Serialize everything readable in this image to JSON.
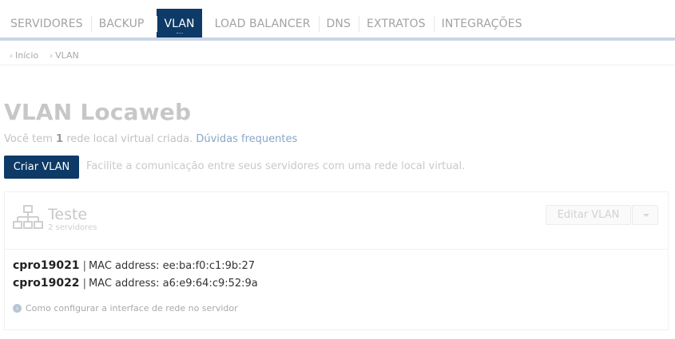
{
  "nav": {
    "tabs": [
      {
        "label": "SERVIDORES"
      },
      {
        "label": "BACKUP"
      },
      {
        "label": "VLAN",
        "active": true
      },
      {
        "label": "LOAD BALANCER"
      },
      {
        "label": "DNS"
      },
      {
        "label": "EXTRATOS"
      },
      {
        "label": "INTEGRAÇÕES"
      }
    ]
  },
  "breadcrumb": [
    "Início",
    "VLAN"
  ],
  "page": {
    "title": "VLAN Locaweb",
    "summary_prefix": "Você tem ",
    "summary_count": "1",
    "summary_suffix": " rede local virtual criada.",
    "faq_link": "Dúvidas frequentes",
    "create_button": "Criar VLAN",
    "create_hint": "Facilite a comunicação entre seus servidores com uma rede local virtual."
  },
  "vlan": {
    "icon": "network-icon",
    "name": "Teste",
    "server_count": "2 servidores",
    "edit_button": "Editar VLAN",
    "servers": [
      {
        "name": "cpro19021",
        "sep": "|",
        "mac": "MAC address: ee:ba:f0:c1:9b:27"
      },
      {
        "name": "cpro19022",
        "sep": "|",
        "mac": "MAC address: a6:e9:64:c9:52:9a"
      }
    ],
    "help_link": "Como configurar a interface de rede no servidor"
  },
  "colors": {
    "primary": "#0d3a66",
    "nav_rule": "#c9d6e6",
    "link": "#8aa6c8"
  }
}
